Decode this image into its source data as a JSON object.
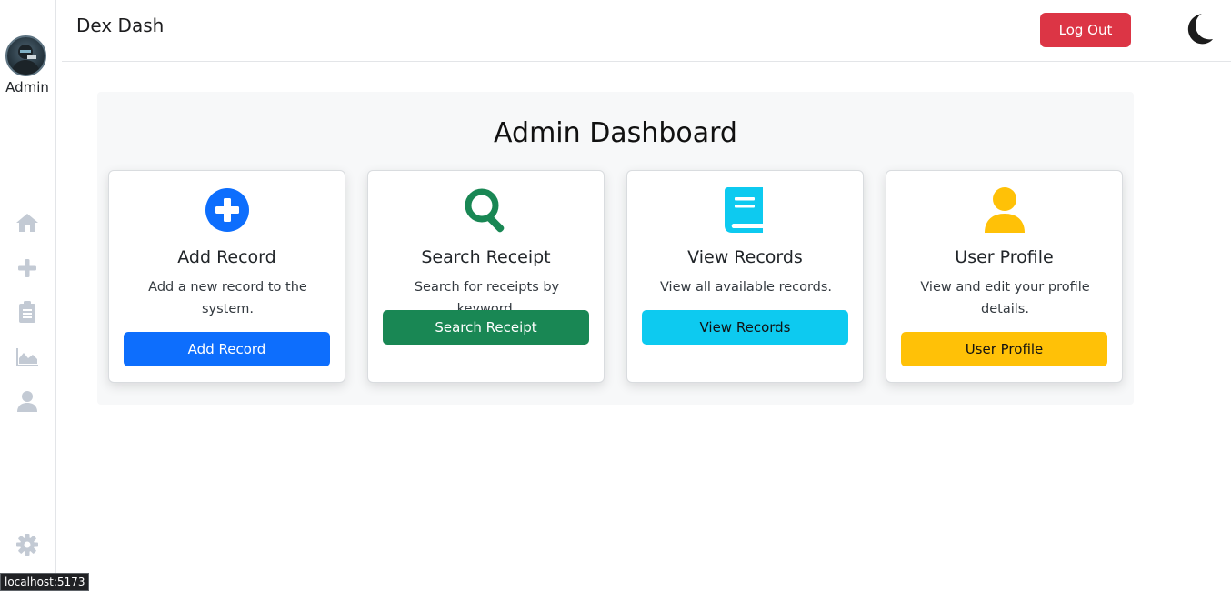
{
  "sidebar": {
    "user_label": "Admin",
    "nav": [
      {
        "icon": "home-icon"
      },
      {
        "icon": "plus-icon"
      },
      {
        "icon": "clipboard-icon"
      },
      {
        "icon": "chart-area-icon"
      },
      {
        "icon": "user-icon"
      }
    ],
    "settings_icon": "gear-icon",
    "icon_color": "#c3cad4"
  },
  "header": {
    "brand": "Dex Dash",
    "logout_label": "Log Out",
    "theme_icon": "moon-icon"
  },
  "main": {
    "title": "Admin Dashboard",
    "cards": [
      {
        "icon": "plus-circle-icon",
        "title": "Add Record",
        "description": "Add a new record to the system.",
        "button": "Add Record",
        "color": "#0d6efd"
      },
      {
        "icon": "search-icon",
        "title": "Search Receipt",
        "description": "Search for receipts by keyword.",
        "button": "Search Receipt",
        "color": "#198754"
      },
      {
        "icon": "book-icon",
        "title": "View Records",
        "description": "View all available records.",
        "button": "View Records",
        "color": "#0dcaf0"
      },
      {
        "icon": "user-icon",
        "title": "User Profile",
        "description": "View and edit your profile details.",
        "button": "User Profile",
        "color": "#ffc107"
      }
    ]
  },
  "status_bar": {
    "url": "localhost:5173"
  }
}
